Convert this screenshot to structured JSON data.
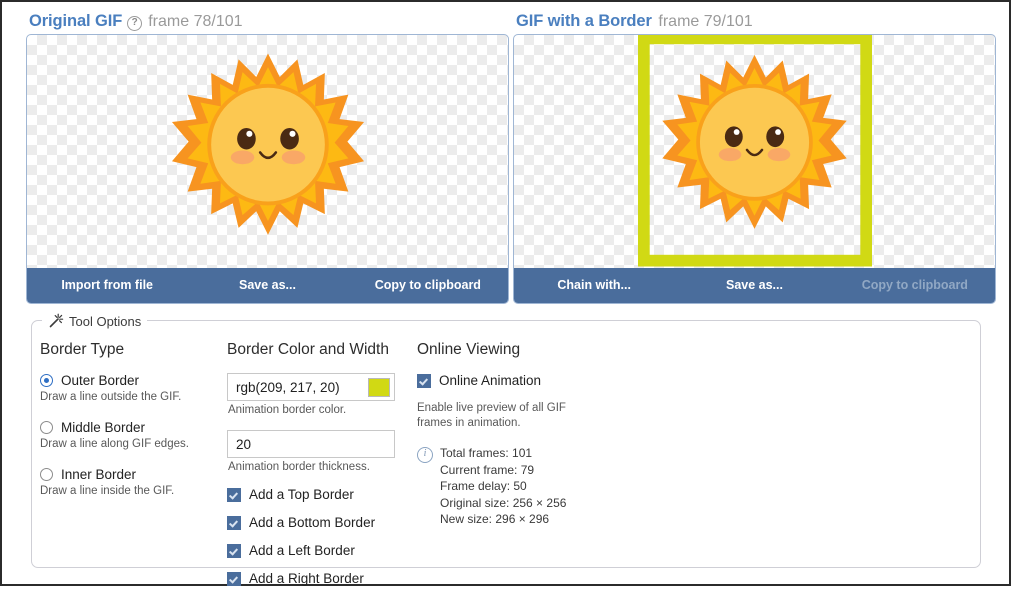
{
  "panels": [
    {
      "id": "original",
      "title": "Original GIF",
      "help_icon": "help-circle-icon",
      "help_glyph": "?",
      "frame_label": "frame 78/101",
      "actions": [
        {
          "label": "Import from file",
          "disabled": false
        },
        {
          "label": "Save as...",
          "disabled": false
        },
        {
          "label": "Copy to clipboard",
          "disabled": false
        }
      ],
      "has_border_overlay": false
    },
    {
      "id": "bordered",
      "title": "GIF with a Border",
      "help_icon": null,
      "help_glyph": "",
      "frame_label": "frame 79/101",
      "actions": [
        {
          "label": "Chain with...",
          "disabled": false
        },
        {
          "label": "Save as...",
          "disabled": false
        },
        {
          "label": "Copy to clipboard",
          "disabled": true
        }
      ],
      "has_border_overlay": true
    }
  ],
  "tool_options": {
    "legend": "Tool Options",
    "legend_icon": "magic-wand-icon",
    "border_type": {
      "heading": "Border Type",
      "options": [
        {
          "label": "Outer Border",
          "hint": "Draw a line outside the GIF.",
          "checked": true
        },
        {
          "label": "Middle Border",
          "hint": "Draw a line along GIF edges.",
          "checked": false
        },
        {
          "label": "Inner Border",
          "hint": "Draw a line inside the GIF.",
          "checked": false
        }
      ]
    },
    "border_color_width": {
      "heading": "Border Color and Width",
      "color_value": "rgb(209, 217, 20)",
      "color_hex": "#d1d914",
      "color_hint": "Animation border color.",
      "width_value": "20",
      "width_hint": "Animation border thickness.",
      "side_checkboxes": [
        {
          "label": "Add a Top Border",
          "checked": true
        },
        {
          "label": "Add a Bottom Border",
          "checked": true
        },
        {
          "label": "Add a Left Border",
          "checked": true
        },
        {
          "label": "Add a Right Border",
          "checked": true
        }
      ]
    },
    "online_viewing": {
      "heading": "Online Viewing",
      "animation_label": "Online Animation",
      "animation_checked": true,
      "animation_hint": "Enable live preview of all GIF frames in animation.",
      "info_icon": "info-circle-icon",
      "info": [
        "Total frames: 101",
        "Current frame: 79",
        "Frame delay: 50",
        "Original size: 256 × 256",
        "New size: 296 × 296"
      ]
    }
  },
  "theme": {
    "accent_blue": "#4a7fbf",
    "bar_blue": "#4a6d9c",
    "border_color": "#d1d914",
    "sun_ray": "#f99d1c",
    "sun_ray_light": "#fdb913",
    "sun_body": "#fcc63f",
    "sun_face": "#4a2c17",
    "cheek": "#f7a072"
  }
}
